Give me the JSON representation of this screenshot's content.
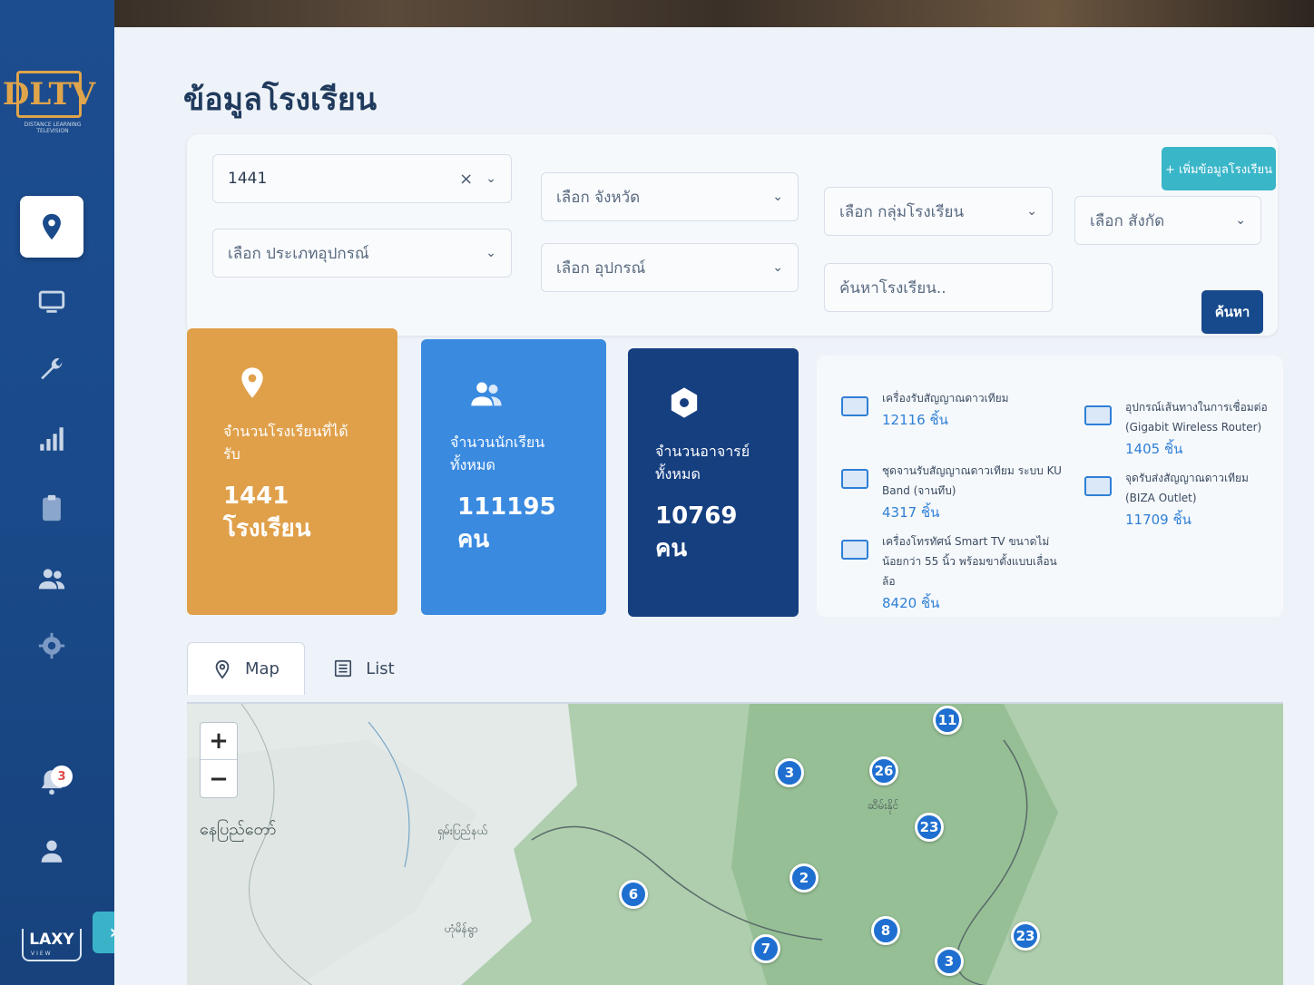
{
  "sidebar": {
    "logo_text": "DLTV",
    "logo_subtitle": "DISTANCE LEARNING TELEVISION",
    "items": [
      {
        "icon": "map-pin-icon"
      },
      {
        "icon": "monitor-icon"
      },
      {
        "icon": "wrench-icon"
      },
      {
        "icon": "bar-chart-icon"
      },
      {
        "icon": "clipboard-icon"
      },
      {
        "icon": "users-icon"
      },
      {
        "icon": "gear-icon"
      },
      {
        "icon": "bell-icon"
      },
      {
        "icon": "user-icon"
      }
    ],
    "notification_count": "3",
    "footer_brand": "LAXY",
    "footer_sub": "VIEW",
    "expand_label": "›"
  },
  "page": {
    "title": "ข้อมูลโรงเรียน"
  },
  "filters": {
    "search_value": "1441",
    "province_placeholder": "เลือก จังหวัด",
    "school_group_placeholder": "เลือก กลุ่มโรงเรียน",
    "affiliation_placeholder": "เลือก สังกัด",
    "device_type_placeholder": "เลือก ประเภทอุปกรณ์",
    "device_placeholder": "เลือก อุปกรณ์",
    "school_search_placeholder": "ค้นหาโรงเรียน..",
    "add_button": "+ เพิ่มข้อมูลโรงเรียน",
    "search_button": "ค้นหา"
  },
  "stats": [
    {
      "label": "จำนวนโรงเรียนที่ได้รับ",
      "value": "1441 โรงเรียน",
      "color": "#e0a04a"
    },
    {
      "label": "จำนวนนักเรียนทั้งหมด",
      "value": "111195 คน",
      "color": "#3a8ae0"
    },
    {
      "label": "จำนวนอาจารย์ทั้งหมด",
      "value": "10769 คน",
      "color": "#163f80"
    }
  ],
  "equipment": [
    {
      "name": "เครื่องรับสัญญาณดาวเทียม",
      "count": "12116 ชิ้น"
    },
    {
      "name": "ชุดจานรับสัญญาณดาวเทียม ระบบ KU Band (จานทึบ)",
      "count": "4317 ชิ้น"
    },
    {
      "name": "เครื่องโทรทัศน์ Smart TV ขนาดไม่น้อยกว่า 55 นิ้ว พร้อมขาตั้งแบบเลื่อนล้อ",
      "count": "8420 ชิ้น"
    },
    {
      "name": "อุปกรณ์เส้นทางในการเชื่อมต่อ (Gigabit Wireless Router)",
      "count": "1405 ชิ้น"
    },
    {
      "name": "จุดรับส่งสัญญาณดาวเทียม (BIZA Outlet)",
      "count": "11709 ชิ้น"
    }
  ],
  "tabs": [
    {
      "label": "Map"
    },
    {
      "label": "List"
    }
  ],
  "map": {
    "zoom_in": "+",
    "zoom_out": "−",
    "labels": [
      "နေပြည်တော်",
      "ရှမ်းပြည်နယ်",
      "ဆီမ်းနိုင်",
      "ဟုံမိန်ရွာ"
    ],
    "clusters": [
      "11",
      "3",
      "26",
      "23",
      "2",
      "6",
      "8",
      "7",
      "23",
      "3"
    ]
  }
}
